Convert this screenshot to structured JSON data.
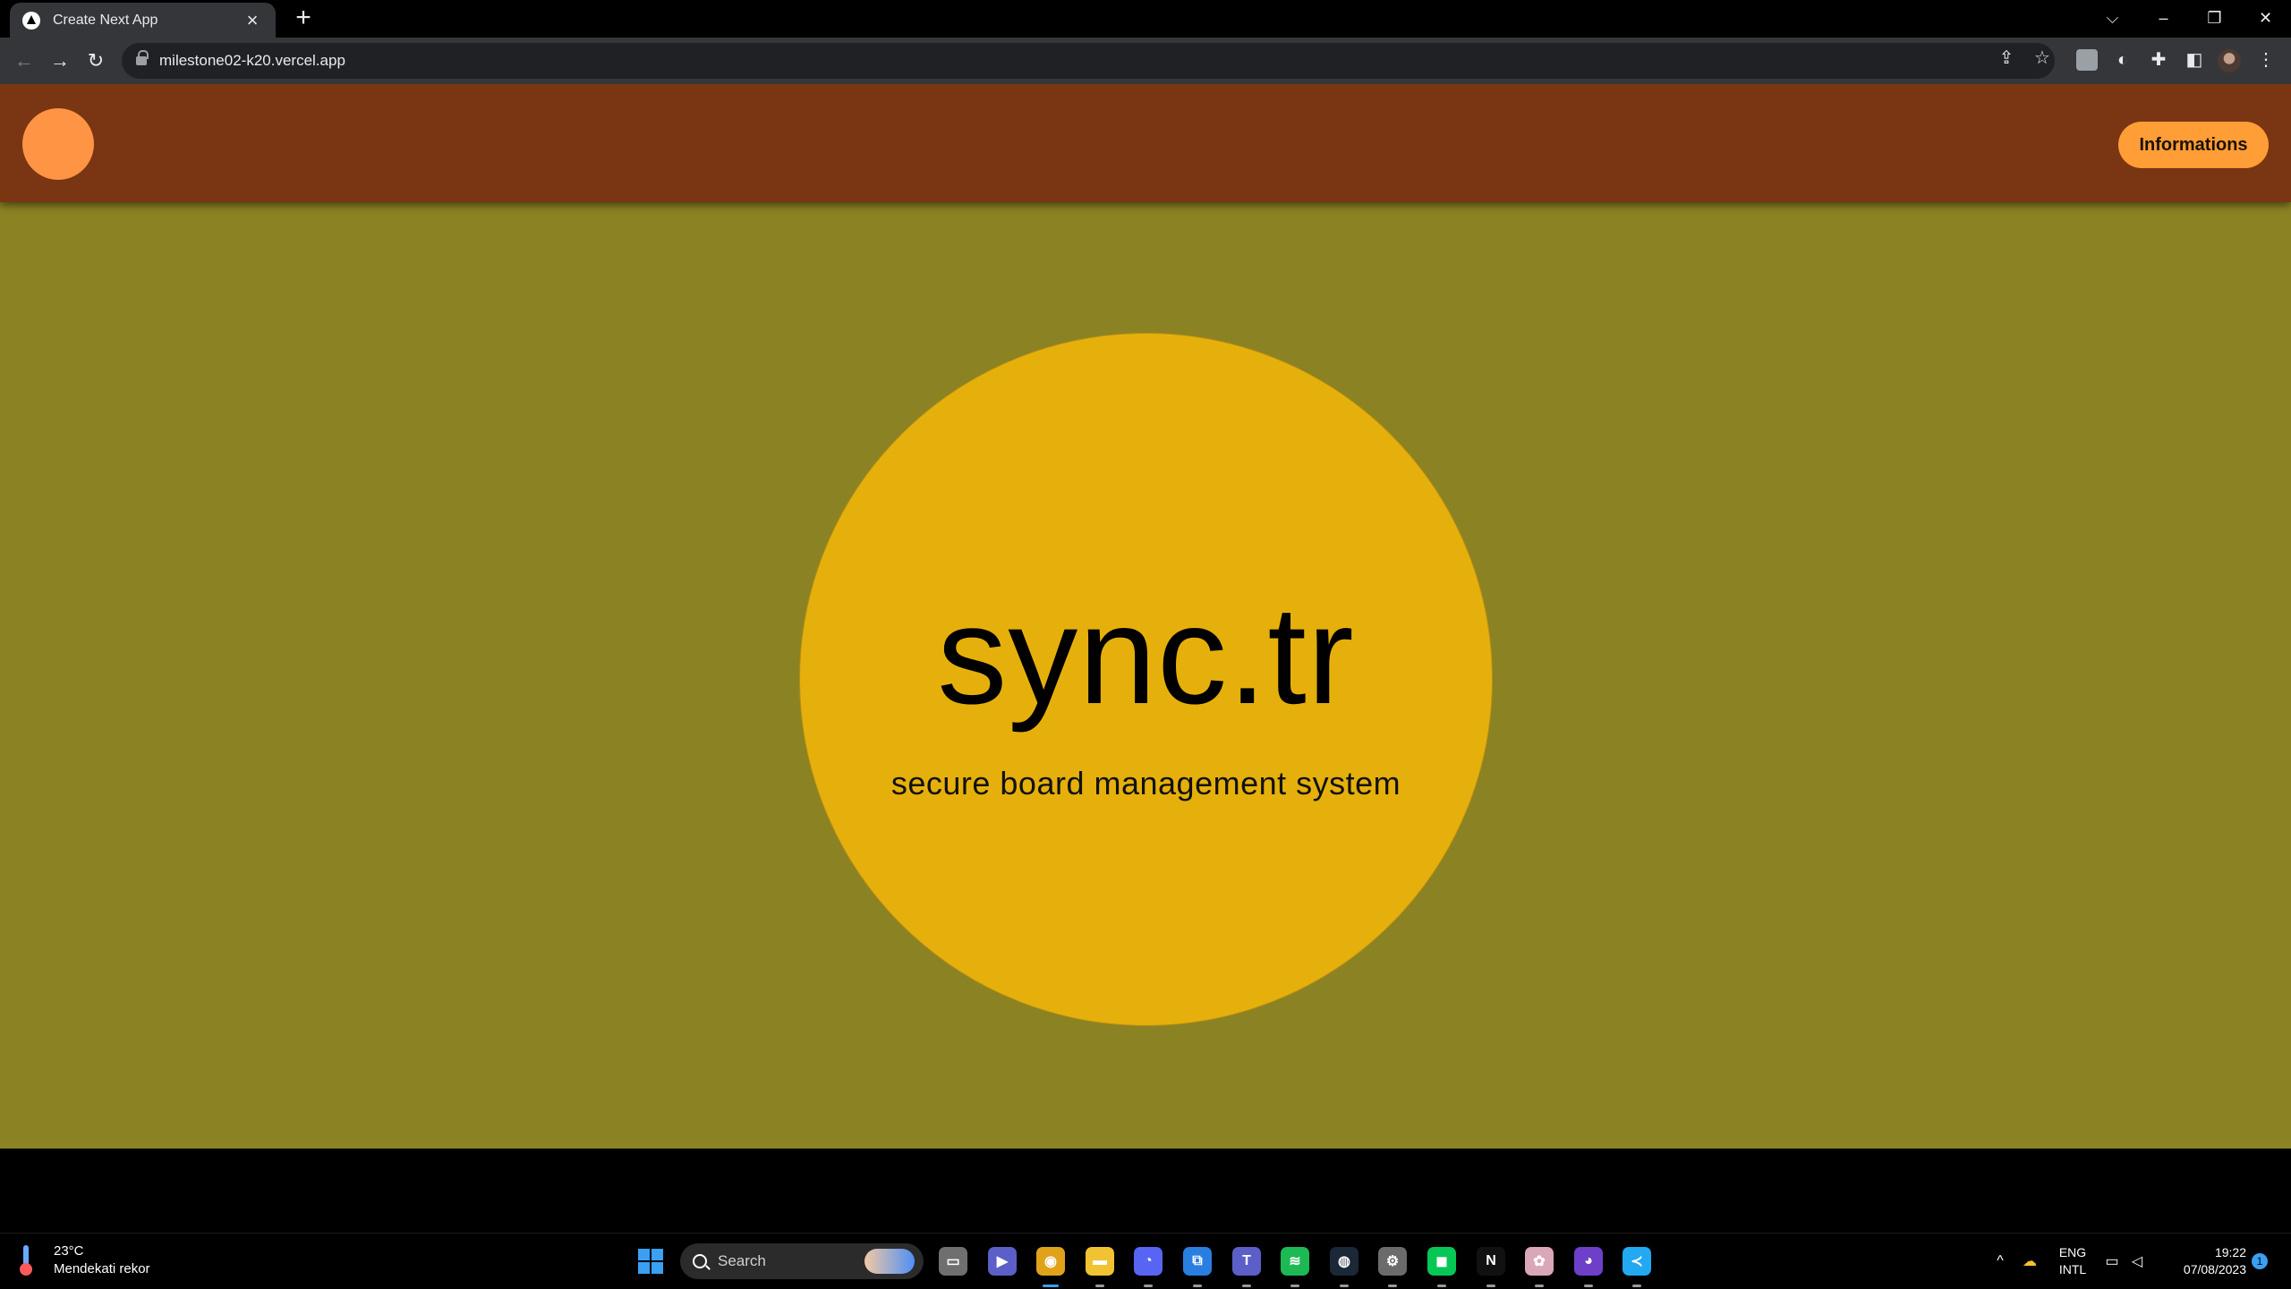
{
  "browser": {
    "tab_title": "Create Next App",
    "tab_close": "×",
    "new_tab": "+",
    "url": "milestone02-k20.vercel.app",
    "window_controls": [
      "⌵",
      "–",
      "❐",
      "✕"
    ]
  },
  "site": {
    "header_button_label": "Informations",
    "title": "sync.tr",
    "subtitle": "secure board management system",
    "colors": {
      "background": "#8b8223",
      "header": "#7a3513",
      "logo_circle": "#ff9444",
      "button": "#ff9d36",
      "hero_circle": "#e6b00c"
    }
  },
  "taskbar": {
    "weather_temp": "23°C",
    "weather_desc": "Mendekati rekor",
    "search_placeholder": "Search",
    "apps": [
      {
        "name": "files-app-icon",
        "glyph": "▭",
        "color": "#6f6f6f"
      },
      {
        "name": "teams-meet-icon",
        "glyph": "▶",
        "color": "#5b5fc7"
      },
      {
        "name": "chrome-icon",
        "glyph": "◉",
        "color": "#e0a21a"
      },
      {
        "name": "file-explorer-icon",
        "glyph": "▬",
        "color": "#f1c232"
      },
      {
        "name": "discord-icon",
        "glyph": "◔",
        "color": "#5865f2"
      },
      {
        "name": "remote-desktop-icon",
        "glyph": "⧉",
        "color": "#2a7ee0"
      },
      {
        "name": "teams-icon",
        "glyph": "T",
        "color": "#5b5fc7"
      },
      {
        "name": "spotify-icon",
        "glyph": "≋",
        "color": "#1db954"
      },
      {
        "name": "steam-icon",
        "glyph": "◍",
        "color": "#1b2838"
      },
      {
        "name": "settings-icon",
        "glyph": "⚙",
        "color": "#6b6b6b"
      },
      {
        "name": "line-icon",
        "glyph": "◼",
        "color": "#06c755"
      },
      {
        "name": "netflix-icon",
        "glyph": "N",
        "color": "#111111"
      },
      {
        "name": "anime-app-icon",
        "glyph": "✿",
        "color": "#d9a7b8"
      },
      {
        "name": "github-icon",
        "glyph": "◕",
        "color": "#6e40c9"
      },
      {
        "name": "vscode-icon",
        "glyph": "≺",
        "color": "#23a8f2"
      }
    ],
    "lang_top": "ENG",
    "lang_bottom": "INTL",
    "time": "19:22",
    "date": "07/08/2023",
    "notification_count": "1"
  }
}
